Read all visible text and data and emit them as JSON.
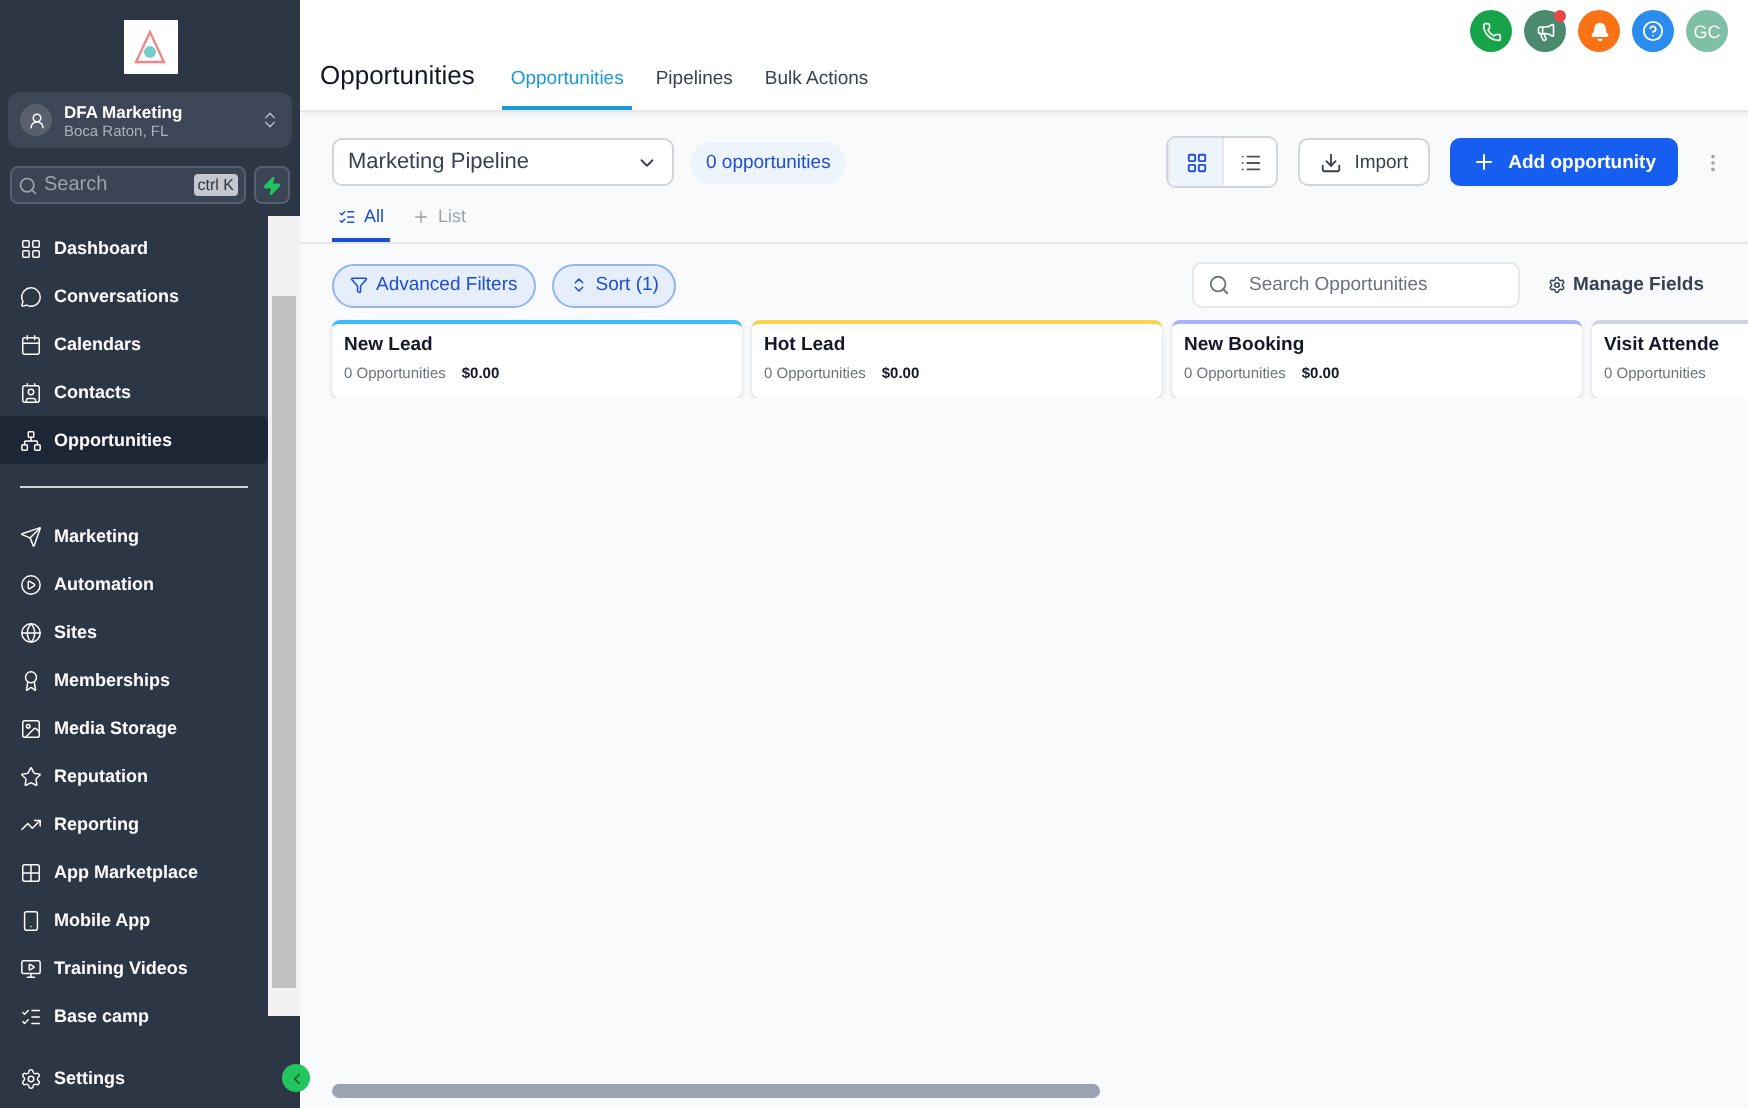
{
  "sidebar": {
    "account": {
      "name": "DFA Marketing",
      "location": "Boca Raton, FL"
    },
    "search": {
      "placeholder": "Search",
      "shortcut": "ctrl K"
    },
    "items": [
      {
        "label": "Dashboard",
        "selected": false
      },
      {
        "label": "Conversations",
        "selected": false
      },
      {
        "label": "Calendars",
        "selected": false
      },
      {
        "label": "Contacts",
        "selected": false
      },
      {
        "label": "Opportunities",
        "selected": true
      }
    ],
    "items2": [
      {
        "label": "Marketing",
        "selected": false
      },
      {
        "label": "Automation",
        "selected": false
      },
      {
        "label": "Sites",
        "selected": false
      },
      {
        "label": "Memberships",
        "selected": false
      },
      {
        "label": "Media Storage",
        "selected": false
      },
      {
        "label": "Reputation",
        "selected": false
      },
      {
        "label": "Reporting",
        "selected": false
      },
      {
        "label": "App Marketplace",
        "selected": false
      },
      {
        "label": "Mobile App",
        "selected": false
      },
      {
        "label": "Training Videos",
        "selected": false
      },
      {
        "label": "Base camp",
        "selected": false
      }
    ],
    "settings": "Settings"
  },
  "topbar": {
    "avatar": "GC"
  },
  "header": {
    "title": "Opportunities",
    "tabs": [
      {
        "label": "Opportunities",
        "selected": true
      },
      {
        "label": "Pipelines",
        "selected": false
      },
      {
        "label": "Bulk Actions",
        "selected": false
      }
    ]
  },
  "toolbar": {
    "pipeline": "Marketing Pipeline",
    "count": "0 opportunities",
    "view_modes": [
      {
        "selected": true
      },
      {
        "selected": false
      }
    ],
    "import": "Import",
    "add": "Add opportunity"
  },
  "views": [
    {
      "label": "All",
      "selected": true
    },
    {
      "label": "List",
      "selected": false
    }
  ],
  "filters": {
    "advanced": "Advanced Filters",
    "sort": "Sort (1)",
    "search_placeholder": "Search Opportunities",
    "manage": "Manage Fields"
  },
  "stages": [
    {
      "name": "New Lead",
      "count": "0 Opportunities",
      "amount": "$0.00",
      "color": "#38bdf8"
    },
    {
      "name": "Hot Lead",
      "count": "0 Opportunities",
      "amount": "$0.00",
      "color": "#fcd34d"
    },
    {
      "name": "New Booking",
      "count": "0 Opportunities",
      "amount": "$0.00",
      "color": "#a5b4fc"
    },
    {
      "name": "Visit Attende",
      "count": "0 Opportunities",
      "color": "#cbd5e1"
    }
  ]
}
